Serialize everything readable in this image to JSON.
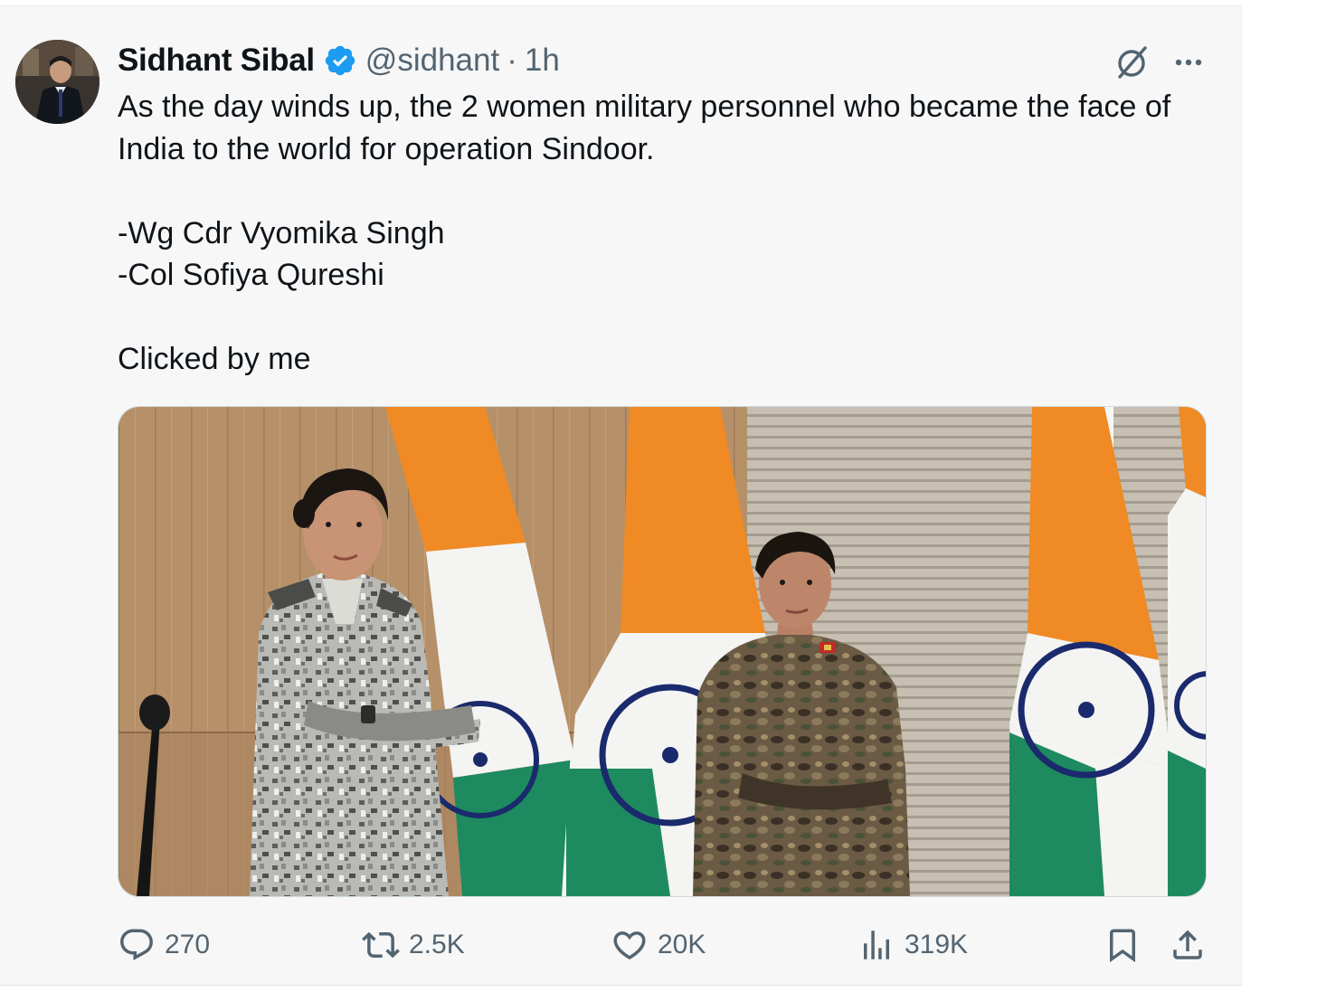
{
  "tweet": {
    "author_name": "Sidhant Sibal",
    "handle": "@sidhant",
    "separator": "·",
    "time": "1h",
    "text_lines": [
      "As the day winds up, the 2 women military personnel who became the face of India to the world for operation Sindoor.",
      "",
      "-Wg Cdr Vyomika Singh",
      "-Col Sofiya Qureshi",
      "",
      "Clicked by me"
    ]
  },
  "actions": {
    "replies": "270",
    "reposts": "2.5K",
    "likes": "20K",
    "views": "319K"
  },
  "icons": {
    "verified": "verified-badge-icon",
    "grok": "grok-icon",
    "more": "more-icon",
    "reply": "reply-icon",
    "repost": "repost-icon",
    "like": "heart-icon",
    "views": "views-icon",
    "bookmark": "bookmark-icon",
    "share": "share-icon"
  },
  "colors": {
    "verified_blue": "#1d9bf0",
    "secondary_text": "#536471",
    "saffron": "#f08a24",
    "green": "#1e8a5f",
    "chakra_navy": "#1a2a6c"
  }
}
